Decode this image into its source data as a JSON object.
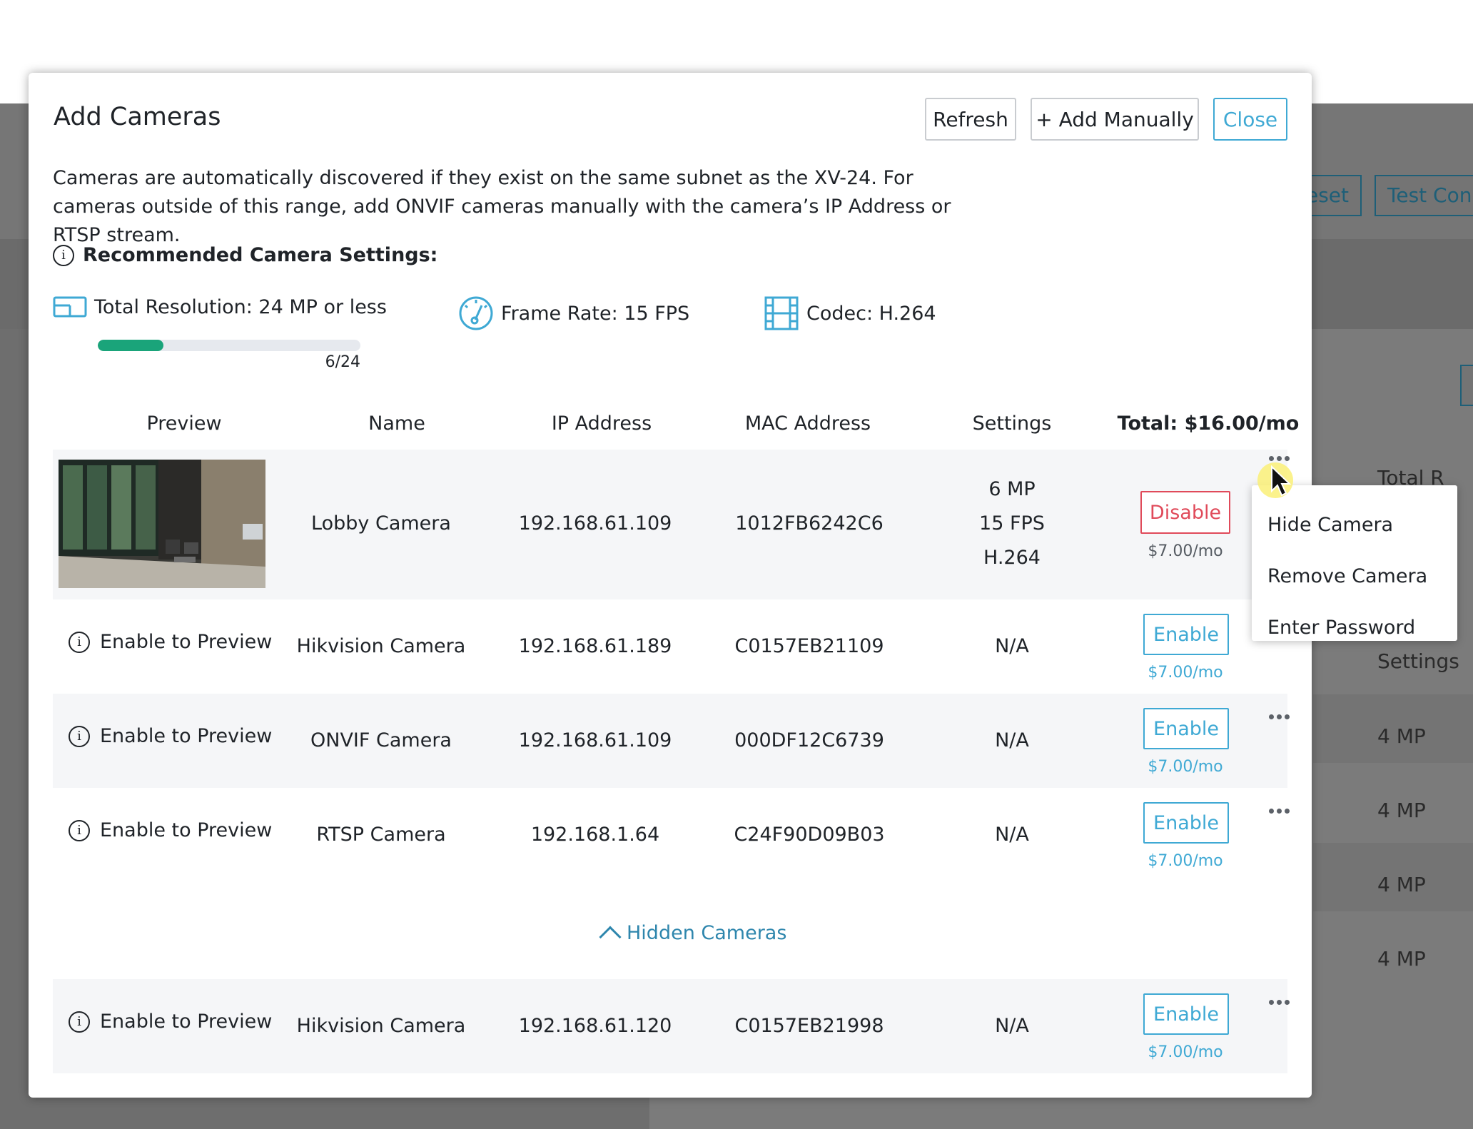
{
  "background": {
    "buttons": [
      "eset",
      "Test Conn"
    ],
    "labels": {
      "total": "Total R",
      "settings": "Settings"
    },
    "rows": [
      "4 MP",
      "4 MP",
      "4 MP",
      "4 MP"
    ]
  },
  "modal": {
    "title": "Add Cameras",
    "buttons": {
      "refresh": "Refresh",
      "add_manually": "+ Add Manually",
      "close": "Close"
    },
    "description": "Cameras are automatically discovered if they exist on the same subnet as the XV-24. For cameras outside of this range, add ONVIF cameras manually with the camera’s IP Address or RTSP stream.",
    "recommended": {
      "title": "Recommended Camera Settings:",
      "resolution": "Total Resolution: 24 MP or less",
      "frame_rate": "Frame Rate: 15 FPS",
      "codec": "Codec: H.264",
      "usage": {
        "used": 6,
        "max": 24,
        "label": "6/24"
      }
    },
    "table": {
      "headers": {
        "preview": "Preview",
        "name": "Name",
        "ip": "IP Address",
        "mac": "MAC Address",
        "settings": "Settings",
        "total": "Total: $16.00/mo"
      },
      "rows": [
        {
          "preview": "",
          "name": "Lobby Camera",
          "ip": "192.168.61.109",
          "mac": "1012FB6242C6",
          "settings": [
            "6 MP",
            "15 FPS",
            "H.264"
          ],
          "action": "Disable",
          "price": "$7.00/mo"
        },
        {
          "preview": "Enable to Preview",
          "name": "Hikvision Camera",
          "ip": "192.168.61.189",
          "mac": "C0157EB21109",
          "settings": [
            "N/A"
          ],
          "action": "Enable",
          "price": "$7.00/mo"
        },
        {
          "preview": "Enable to Preview",
          "name": "ONVIF Camera",
          "ip": "192.168.61.109",
          "mac": "000DF12C6739",
          "settings": [
            "N/A"
          ],
          "action": "Enable",
          "price": "$7.00/mo"
        },
        {
          "preview": "Enable to Preview",
          "name": "RTSP Camera",
          "ip": "192.168.1.64",
          "mac": "C24F90D09B03",
          "settings": [
            "N/A"
          ],
          "action": "Enable",
          "price": "$7.00/mo"
        }
      ],
      "hidden_toggle": "Hidden Cameras",
      "hidden_rows": [
        {
          "preview": "Enable to Preview",
          "name": "Hikvision Camera",
          "ip": "192.168.61.120",
          "mac": "C0157EB21998",
          "settings": [
            "N/A"
          ],
          "action": "Enable",
          "price": "$7.00/mo"
        }
      ]
    },
    "menu": {
      "items": [
        "Hide Camera",
        "Remove Camera",
        "Enter Password"
      ]
    }
  },
  "icons": {
    "resolution": "monitor-icon",
    "frame_rate": "gauge-icon",
    "codec": "film-icon",
    "info": "info-icon",
    "more": "more-dots-icon"
  },
  "colors": {
    "accent": "#3fa9d4",
    "danger": "#e04a5a",
    "progress": "#1aa47a",
    "link": "#2e86ad"
  }
}
